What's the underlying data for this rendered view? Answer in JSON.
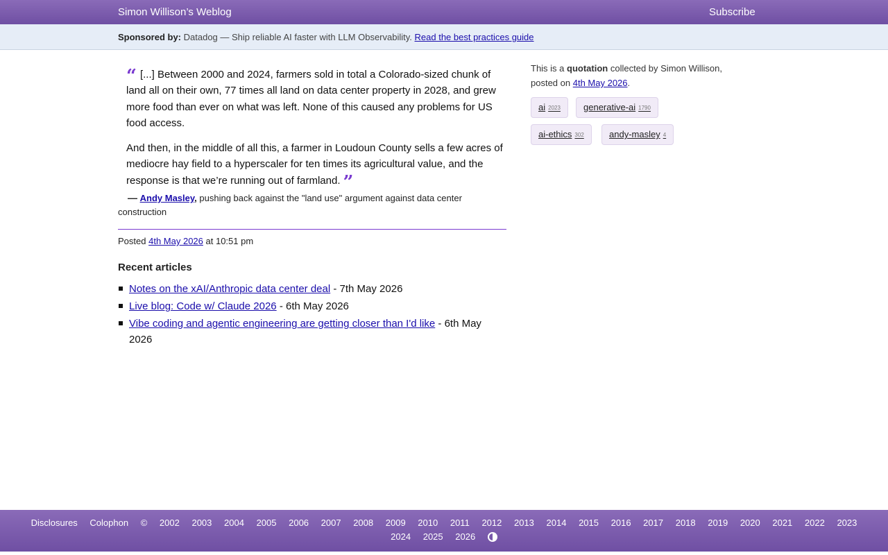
{
  "header": {
    "site_title": "Simon Willison’s Weblog",
    "subscribe_label": "Subscribe"
  },
  "sponsor": {
    "label": "Sponsored by:",
    "text": "Datadog — Ship reliable AI faster with LLM Observability.",
    "link": "Read the best practices guide"
  },
  "quote": {
    "open_mark": "“",
    "close_mark": "”",
    "paragraph1": "[...] Between 2000 and 2024, farmers sold in total a Colorado-sized chunk of land all on their own, 77 times all land on data center property in 2028, and grew more food than ever on what was left. None of this caused any problems for US food access.",
    "paragraph2": "And then, in the middle of all this, a farmer in Loudoun County sells a few acres of mediocre hay field to a hyperscaler for ten times its agricultural value, and the response is that we’re running out of farmland."
  },
  "citation": {
    "dash": "—",
    "author": "Andy Masley",
    "comma": ",",
    "context": "pushing back against the \"land use\" argument against data center construction"
  },
  "posted": {
    "prefix": "Posted",
    "date": "4th May 2026",
    "time": "at 10:51 pm"
  },
  "recent": {
    "heading": "Recent articles",
    "items": [
      {
        "title": "Notes on the xAI/Anthropic data center deal",
        "date": "- 7th May 2026"
      },
      {
        "title": "Live blog: Code w/ Claude 2026",
        "date": "- 6th May 2026"
      },
      {
        "title": "Vibe coding and agentic engineering are getting closer than I'd like",
        "date": "- 6th May 2026"
      }
    ]
  },
  "sidebar": {
    "intro_prefix": "This is a",
    "intro_type": "quotation",
    "intro_mid": "collected by Simon Willison, posted on",
    "intro_date": "4th May 2026",
    "intro_end": ".",
    "tags": [
      {
        "name": "ai",
        "count": "2023"
      },
      {
        "name": "generative-ai",
        "count": "1790"
      },
      {
        "name": "ai-ethics",
        "count": "302"
      },
      {
        "name": "andy-masley",
        "count": "4"
      }
    ]
  },
  "footer": {
    "disclosures": "Disclosures",
    "colophon": "Colophon",
    "copyright": "©",
    "years_row1": [
      "2002",
      "2003",
      "2004",
      "2005",
      "2006",
      "2007",
      "2008",
      "2009",
      "2010",
      "2011",
      "2012",
      "2013",
      "2014",
      "2015",
      "2016",
      "2017",
      "2018",
      "2019",
      "2020",
      "2021",
      "2022",
      "2023"
    ],
    "years_row2": [
      "2024",
      "2025",
      "2026"
    ],
    "contrast_icon": "contrast-icon"
  },
  "colors": {
    "brand_purple": "#7a3bd0",
    "header_bg": "#7a5cae",
    "link": "#1a0dab",
    "sponsor_bg": "#e6edf7",
    "tag_bg": "#f1ebf7"
  }
}
